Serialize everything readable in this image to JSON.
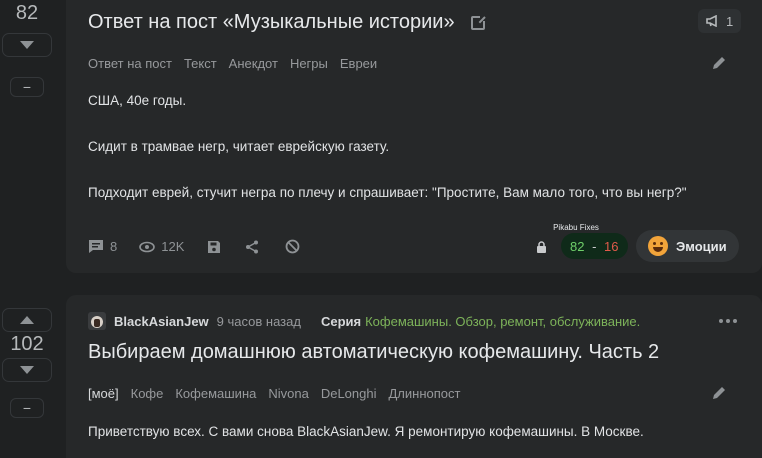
{
  "post1": {
    "score": "82",
    "minus_label": "−",
    "title": "Ответ на пост «Музыкальные истории»",
    "pin_count": "1",
    "tags": [
      "Ответ на пост",
      "Текст",
      "Анекдот",
      "Негры",
      "Евреи"
    ],
    "paragraphs": [
      "США, 40е годы.",
      "Сидит в трамвае негр, читает еврейскую газету.",
      "Подходит еврей, стучит негра по плечу и спрашивает: \"Простите, Вам мало того, что вы негр?\""
    ],
    "comments": "8",
    "views": "12K",
    "pikabu_fixes_label": "Pikabu Fixes",
    "rating_plus": "82",
    "rating_sep": " - ",
    "rating_minus": "16",
    "emotions_label": "Эмоции"
  },
  "post2": {
    "score": "102",
    "minus_label": "−",
    "author": "BlackAsianJew",
    "time": "9 часов назад",
    "series_label": "Серия",
    "series_name": "Кофемашины. Обзор, ремонт, обслуживание.",
    "title": "Выбираем домашнюю автоматическую кофемашину. Часть 2",
    "tags": [
      "[моё]",
      "Кофе",
      "Кофемашина",
      "Nivona",
      "DeLonghi",
      "Длиннопост"
    ],
    "intro": "Приветствую всех. С вами снова BlackAsianJew. Я ремонтирую кофемашины. В Москве."
  },
  "colors": {
    "background": "#1f2122",
    "card": "#262829",
    "text": "#e6e8ea",
    "muted": "#97999c",
    "series_green": "#7db35a",
    "rating_plus": "#6fcf6a",
    "rating_minus": "#e05a4a"
  }
}
